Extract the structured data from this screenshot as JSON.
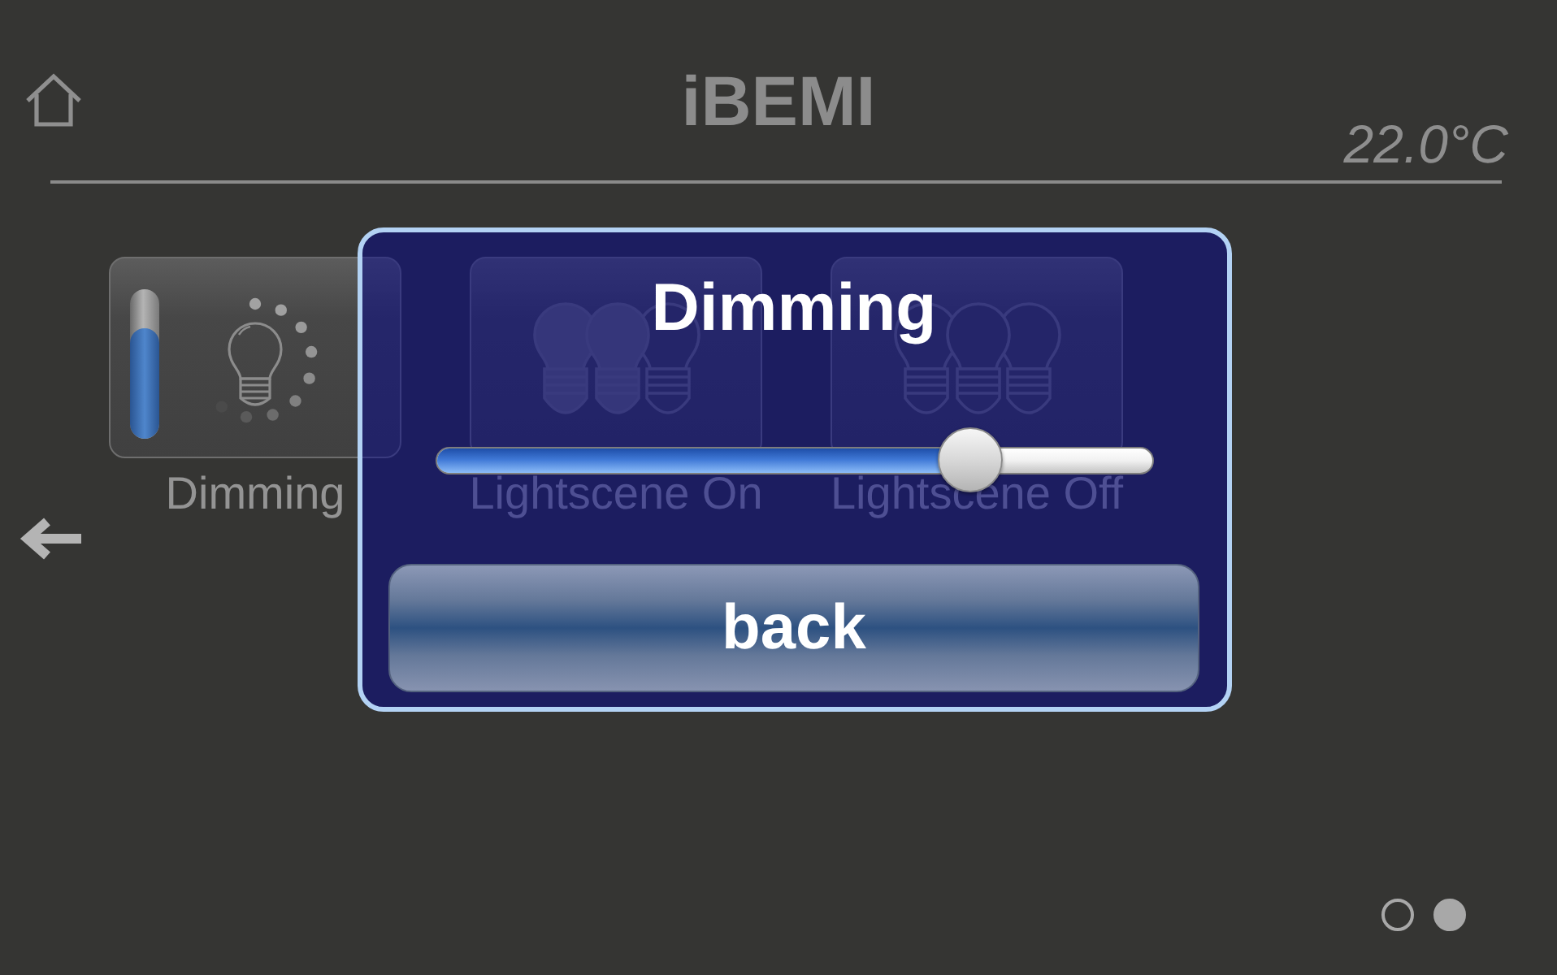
{
  "header": {
    "title": "iBEMI",
    "temperature": "22.0°C"
  },
  "tiles": [
    {
      "kind": "dimmer",
      "label": "Dimming",
      "level": 0.74
    },
    {
      "kind": "scene_on",
      "label": "Lightscene On"
    },
    {
      "kind": "scene_off",
      "label": "Lightscene Off"
    }
  ],
  "pager": [
    {
      "selected": false
    },
    {
      "selected": true
    }
  ],
  "dialog": {
    "title": "Dimming",
    "slider": {
      "level": 0.745
    },
    "button": "back"
  }
}
